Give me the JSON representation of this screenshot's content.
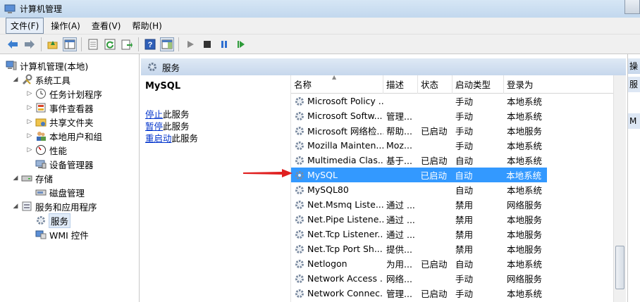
{
  "window": {
    "title": "计算机管理"
  },
  "menu": [
    "文件(F)",
    "操作(A)",
    "查看(V)",
    "帮助(H)"
  ],
  "tree": [
    {
      "label": "计算机管理(本地)",
      "icon": "computer-icon",
      "level": 0
    },
    {
      "label": "系统工具",
      "icon": "tools-icon",
      "level": 1,
      "expanded": true
    },
    {
      "label": "任务计划程序",
      "icon": "clock-icon",
      "level": 2
    },
    {
      "label": "事件查看器",
      "icon": "event-viewer-icon",
      "level": 2
    },
    {
      "label": "共享文件夹",
      "icon": "shared-folder-icon",
      "level": 2
    },
    {
      "label": "本地用户和组",
      "icon": "users-icon",
      "level": 2
    },
    {
      "label": "性能",
      "icon": "performance-icon",
      "level": 2
    },
    {
      "label": "设备管理器",
      "icon": "device-manager-icon",
      "level": 2
    },
    {
      "label": "存储",
      "icon": "storage-icon",
      "level": 1,
      "expanded": true
    },
    {
      "label": "磁盘管理",
      "icon": "disk-icon",
      "level": 2
    },
    {
      "label": "服务和应用程序",
      "icon": "services-apps-icon",
      "level": 1,
      "expanded": true
    },
    {
      "label": "服务",
      "icon": "services-icon",
      "level": 2,
      "selected": true
    },
    {
      "label": "WMI 控件",
      "icon": "wmi-icon",
      "level": 2
    }
  ],
  "services_header": {
    "title": "服务"
  },
  "detail": {
    "service_name": "MySQL",
    "actions": [
      {
        "link": "停止",
        "rest": "此服务"
      },
      {
        "link": "暂停",
        "rest": "此服务"
      },
      {
        "link": "重启动",
        "rest": "此服务"
      }
    ]
  },
  "columns": {
    "name": "名称",
    "desc": "描述",
    "status": "状态",
    "startup": "启动类型",
    "logon": "登录为"
  },
  "rows": [
    {
      "name": "Microsoft Policy ...",
      "desc": "",
      "status": "",
      "startup": "手动",
      "logon": "本地系统"
    },
    {
      "name": "Microsoft Softw...",
      "desc": "管理...",
      "status": "",
      "startup": "手动",
      "logon": "本地系统"
    },
    {
      "name": "Microsoft 网络检...",
      "desc": "帮助...",
      "status": "已启动",
      "startup": "手动",
      "logon": "本地服务"
    },
    {
      "name": "Mozilla Mainten...",
      "desc": "Moz...",
      "status": "",
      "startup": "手动",
      "logon": "本地系统"
    },
    {
      "name": "Multimedia Clas...",
      "desc": "基于...",
      "status": "已启动",
      "startup": "自动",
      "logon": "本地系统"
    },
    {
      "name": "MySQL",
      "desc": "",
      "status": "已启动",
      "startup": "自动",
      "logon": "本地系统",
      "selected": true
    },
    {
      "name": "MySQL80",
      "desc": "",
      "status": "",
      "startup": "自动",
      "logon": "本地系统"
    },
    {
      "name": "Net.Msmq Liste...",
      "desc": "通过 ...",
      "status": "",
      "startup": "禁用",
      "logon": "网络服务"
    },
    {
      "name": "Net.Pipe Listene...",
      "desc": "通过 ...",
      "status": "",
      "startup": "禁用",
      "logon": "本地服务"
    },
    {
      "name": "Net.Tcp Listener...",
      "desc": "通过 ...",
      "status": "",
      "startup": "禁用",
      "logon": "本地服务"
    },
    {
      "name": "Net.Tcp Port Sh...",
      "desc": "提供...",
      "status": "",
      "startup": "禁用",
      "logon": "本地服务"
    },
    {
      "name": "Netlogon",
      "desc": "为用...",
      "status": "已启动",
      "startup": "自动",
      "logon": "本地系统"
    },
    {
      "name": "Network Access ...",
      "desc": "网络...",
      "status": "",
      "startup": "手动",
      "logon": "网络服务"
    },
    {
      "name": "Network Connec...",
      "desc": "管理...",
      "status": "已启动",
      "startup": "手动",
      "logon": "本地系统"
    }
  ],
  "right_pane": {
    "head": "操",
    "item1": "服",
    "item2": "M"
  },
  "colors": {
    "selection": "#3399ff",
    "annotation_arrow": "#e02020",
    "link": "#0033cc"
  }
}
